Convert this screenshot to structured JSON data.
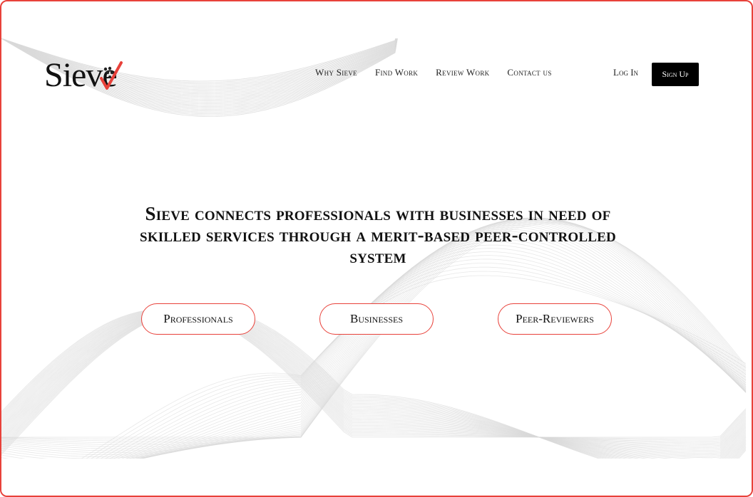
{
  "brand": {
    "name": "Sieve",
    "accent_color": "#e8413a",
    "icon": "checkmark-icon"
  },
  "nav": {
    "items": [
      {
        "label": "Why Sieve"
      },
      {
        "label": "Find Work"
      },
      {
        "label": "Review Work"
      },
      {
        "label": "Contact us"
      }
    ],
    "login_label": "Log In",
    "signup_label": "Sign Up"
  },
  "hero": {
    "headline": "Sieve connects professionals with businesses in need of skilled services through a merit-based peer-controlled system",
    "buttons": [
      {
        "label": "Professionals"
      },
      {
        "label": "Businesses"
      },
      {
        "label": "Peer-Reviewers"
      }
    ]
  },
  "colors": {
    "frame_border": "#e8413a",
    "signup_bg": "#000000",
    "wave_lines": "#d9d9d9"
  }
}
